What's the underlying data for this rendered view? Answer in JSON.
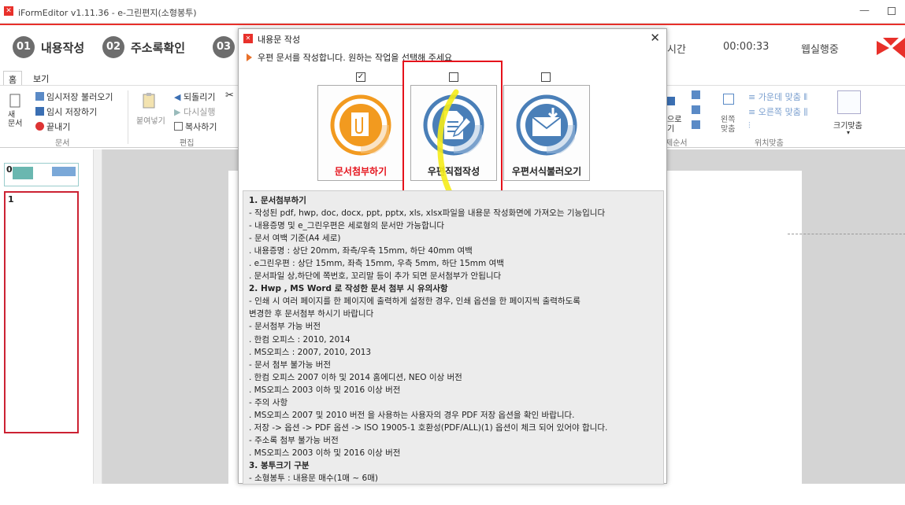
{
  "window": {
    "title": "iFormEditor v1.11.36 - e-그린편지(소형봉투)"
  },
  "steps": [
    {
      "num": "01",
      "label": "내용작성"
    },
    {
      "num": "02",
      "label": "주소록확인"
    },
    {
      "num": "03",
      "label": ""
    }
  ],
  "header_right": {
    "time_label": "시간",
    "time_value": "00:00:33",
    "status": "웹실행중"
  },
  "tabs": [
    "홈",
    "보기"
  ],
  "ribbon": {
    "new_doc": "새\n문서",
    "temp_load": "임시저장 불러오기",
    "temp_save": "임시 저장하기",
    "exit": "끝내기",
    "group_doc": "문서",
    "paste": "붙여넣기",
    "undo": "되돌리기",
    "redo": "다시실행",
    "copy": "복사하기",
    "group_edit": "편집",
    "order_to": "으로",
    "order_to2": "기",
    "order_group": "제순서",
    "align_left_left": "왼쪽",
    "align_left_right": "맞춤",
    "align_center": "가운데 맞춤",
    "align_right": "오른쪽 맞춤",
    "group_align": "위치맞춤",
    "fit_size": "크기맞춤"
  },
  "pages": [
    "0",
    "1"
  ],
  "dialog": {
    "title": "내용문 작성",
    "prompt": "우편 문서를 작성합니다. 원하는 작업을 선택해 주세요",
    "options": [
      {
        "label": "문서첨부하기",
        "checked": true,
        "color": "#f29a1f",
        "icon": "paperclip-icon"
      },
      {
        "label": "우편직접작성",
        "checked": false,
        "color": "#4a7fb8",
        "icon": "document-edit-icon"
      },
      {
        "label": "우편서식불러오기",
        "checked": false,
        "color": "#4a7fb8",
        "icon": "envelope-download-icon"
      }
    ],
    "check_mark": "✓",
    "notes": [
      {
        "text": "1. 문서첨부하기",
        "heading": true
      },
      {
        "text": " - 작성된 pdf, hwp, doc, docx, ppt, pptx, xls, xlsx파일을 내용문 작성화면에 가져오는 기능입니다",
        "heading": false
      },
      {
        "text": " - 내용증명 및 e_그린우편은 세로형의 문서만 가능합니다",
        "heading": false
      },
      {
        "text": " - 문서 여백 기준(A4 세로)",
        "heading": false
      },
      {
        "text": "   . 내용증명  : 상단 20mm, 좌측/우측 15mm, 하단 40mm 여백",
        "heading": false
      },
      {
        "text": "   . e그린우편 : 상단 15mm, 좌측 15mm, 우측 5mm, 하단 15mm 여백",
        "heading": false
      },
      {
        "text": "   . 문서파일 상,하단에 쪽번호, 꼬리말 등이 추가 되면 문서첨부가 안됩니다",
        "heading": false
      },
      {
        "text": "2. Hwp , MS Word 로 작성한 문서 첨부 시  유의사항",
        "heading": true
      },
      {
        "text": " - 인쇄 시 여러 페이지를 한 페이지에  출력하게 설정한 경우, 인쇄 옵션을 한 페이지씩 출력하도록",
        "heading": false
      },
      {
        "text": "   변경한 후 문서첨부 하시기 바랍니다",
        "heading": false
      },
      {
        "text": " - 문서첨부 가능 버전",
        "heading": false
      },
      {
        "text": "   . 한컴 오피스 : 2010, 2014",
        "heading": false
      },
      {
        "text": "   . MS오피스 : 2007, 2010, 2013",
        "heading": false
      },
      {
        "text": " - 문서 첨부 불가능 버전",
        "heading": false
      },
      {
        "text": "   . 한컴 오피스 2007 이하 및 2014 홈에디션, NEO 이상 버전",
        "heading": false
      },
      {
        "text": "   . MS오피스 2003 이하 및 2016 이상 버전",
        "heading": false
      },
      {
        "text": " - 주의 사항",
        "heading": false
      },
      {
        "text": "   . MS오피스 2007 및 2010 버전 을 사용하는 사용자의 경우 PDF 저장 옵션을 확인 바랍니다.",
        "heading": false
      },
      {
        "text": "   . 저장 -> 옵션 -> PDF 옵션 -> ISO 19005-1 호환성(PDF/ALL)(1) 옵션이 체크 되어 있어야 합니다.",
        "heading": false
      },
      {
        "text": " - 주소록 첨부 불가능 버전",
        "heading": false
      },
      {
        "text": "   . MS오피스 2003 이하 및 2016 이상 버전",
        "heading": false
      },
      {
        "text": "3. 봉투크기 구분",
        "heading": true
      },
      {
        "text": " - 소형봉투 : 내용문 매수(1매 ~ 6매)",
        "heading": false
      }
    ]
  },
  "colors": {
    "accent": "#e8302a",
    "highlight": "#e5121b",
    "orange": "#f29a1f",
    "blue": "#4a7fb8"
  }
}
